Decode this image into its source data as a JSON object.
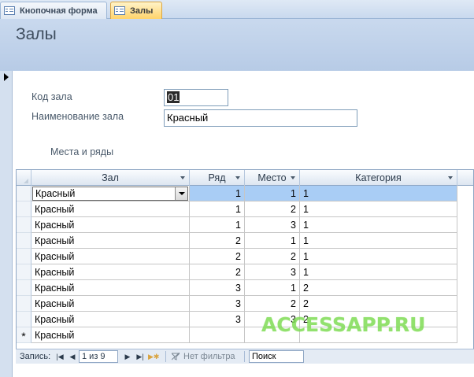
{
  "tabs": [
    {
      "label": "Кнопочная форма",
      "icon": "form-icon",
      "active": false
    },
    {
      "label": "Залы",
      "icon": "form-icon",
      "active": true
    }
  ],
  "form": {
    "title": "Залы",
    "fields": [
      {
        "label": "Код зала",
        "value": "01"
      },
      {
        "label": "Наименование зала",
        "value": "Красный"
      }
    ],
    "subform_label": "Места и ряды"
  },
  "datasheet": {
    "columns": [
      "Зал",
      "Ряд",
      "Место",
      "Категория"
    ],
    "rows": [
      {
        "zal": "Красный",
        "riad": "1",
        "mesto": "1",
        "kat": "1"
      },
      {
        "zal": "Красный",
        "riad": "1",
        "mesto": "2",
        "kat": "1"
      },
      {
        "zal": "Красный",
        "riad": "1",
        "mesto": "3",
        "kat": "1"
      },
      {
        "zal": "Красный",
        "riad": "2",
        "mesto": "1",
        "kat": "1"
      },
      {
        "zal": "Красный",
        "riad": "2",
        "mesto": "2",
        "kat": "1"
      },
      {
        "zal": "Красный",
        "riad": "2",
        "mesto": "3",
        "kat": "1"
      },
      {
        "zal": "Красный",
        "riad": "3",
        "mesto": "1",
        "kat": "2"
      },
      {
        "zal": "Красный",
        "riad": "3",
        "mesto": "2",
        "kat": "2"
      },
      {
        "zal": "Красный",
        "riad": "3",
        "mesto": "3",
        "kat": "2"
      }
    ],
    "new_row": {
      "marker": "*",
      "zal": "Красный"
    }
  },
  "navigation": {
    "label": "Запись:",
    "position": "1 из 9",
    "filter": "Нет фильтра",
    "search": "Поиск"
  },
  "watermark": "ACCESSAPP.RU",
  "colors": {
    "accent_header": "#c9d9ee",
    "active_tab": "#ffd36b",
    "selected_row": "#a9cdf5",
    "watermark": "#7fdc55"
  }
}
